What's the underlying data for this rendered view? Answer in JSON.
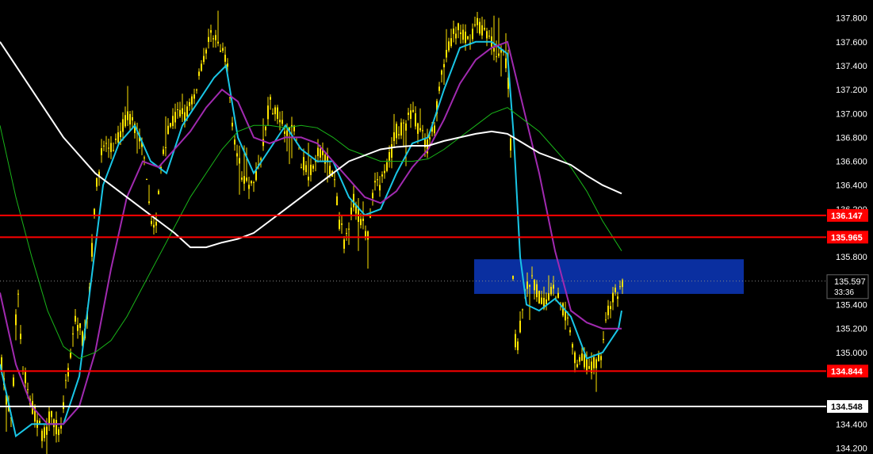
{
  "chart_data": {
    "type": "candlestick",
    "y_axis": {
      "ticks": [
        "137.800",
        "137.600",
        "137.400",
        "137.200",
        "137.000",
        "136.800",
        "136.600",
        "136.400",
        "136.200",
        "135.800",
        "135.400",
        "135.200",
        "135.000",
        "134.400",
        "134.200"
      ],
      "range": [
        134.15,
        137.95
      ],
      "position": "right"
    },
    "grid": false,
    "current_price": {
      "value": "135.597",
      "timer": "33:36"
    },
    "horizontal_levels": [
      {
        "value": "136.147",
        "color": "#ff0000"
      },
      {
        "value": "135.965",
        "color": "#ff0000"
      },
      {
        "value": "134.844",
        "color": "#ff0000"
      },
      {
        "value": "134.548",
        "color": "#ffffff"
      }
    ],
    "zone": {
      "from": 135.49,
      "to": 135.78,
      "color": "#0a2fa0"
    },
    "candle_color": "#ffe400",
    "moving_averages": [
      {
        "color": "#19c6e6"
      },
      {
        "color": "#a12ab0"
      },
      {
        "color": "#19b519"
      },
      {
        "color": "#ffffff"
      }
    ],
    "price_path": [
      [
        0,
        135.0
      ],
      [
        8,
        134.6
      ],
      [
        15,
        134.4
      ],
      [
        22,
        135.6
      ],
      [
        28,
        134.9
      ],
      [
        38,
        134.6
      ],
      [
        48,
        134.4
      ],
      [
        55,
        134.3
      ],
      [
        65,
        134.5
      ],
      [
        75,
        134.3
      ],
      [
        85,
        134.8
      ],
      [
        95,
        135.3
      ],
      [
        105,
        135.1
      ],
      [
        112,
        135.4
      ],
      [
        120,
        136.3
      ],
      [
        130,
        136.75
      ],
      [
        140,
        136.7
      ],
      [
        150,
        136.8
      ],
      [
        160,
        137.0
      ],
      [
        170,
        136.9
      ],
      [
        180,
        136.7
      ],
      [
        188,
        136.2
      ],
      [
        196,
        136.0
      ],
      [
        205,
        136.7
      ],
      [
        215,
        136.9
      ],
      [
        225,
        137.0
      ],
      [
        235,
        137.0
      ],
      [
        245,
        137.15
      ],
      [
        255,
        137.45
      ],
      [
        263,
        137.6
      ],
      [
        270,
        137.7
      ],
      [
        278,
        137.5
      ],
      [
        285,
        137.5
      ],
      [
        292,
        137.0
      ],
      [
        300,
        136.6
      ],
      [
        310,
        136.4
      ],
      [
        320,
        136.4
      ],
      [
        330,
        136.7
      ],
      [
        340,
        137.1
      ],
      [
        350,
        137.0
      ],
      [
        360,
        136.8
      ],
      [
        370,
        136.9
      ],
      [
        380,
        136.6
      ],
      [
        390,
        136.5
      ],
      [
        400,
        136.7
      ],
      [
        410,
        136.65
      ],
      [
        420,
        136.5
      ],
      [
        428,
        136.1
      ],
      [
        435,
        135.9
      ],
      [
        445,
        136.3
      ],
      [
        455,
        136.1
      ],
      [
        465,
        135.95
      ],
      [
        472,
        136.5
      ],
      [
        480,
        136.4
      ],
      [
        490,
        136.6
      ],
      [
        500,
        136.85
      ],
      [
        510,
        136.9
      ],
      [
        520,
        137.0
      ],
      [
        530,
        136.85
      ],
      [
        540,
        136.7
      ],
      [
        548,
        136.9
      ],
      [
        556,
        137.3
      ],
      [
        564,
        137.5
      ],
      [
        572,
        137.65
      ],
      [
        580,
        137.7
      ],
      [
        590,
        137.6
      ],
      [
        600,
        137.75
      ],
      [
        610,
        137.7
      ],
      [
        620,
        137.6
      ],
      [
        630,
        137.5
      ],
      [
        640,
        137.4
      ],
      [
        645,
        136.6
      ],
      [
        648,
        135.2
      ],
      [
        652,
        135.0
      ],
      [
        658,
        135.3
      ],
      [
        664,
        135.55
      ],
      [
        672,
        135.6
      ],
      [
        680,
        135.45
      ],
      [
        688,
        135.4
      ],
      [
        696,
        135.55
      ],
      [
        706,
        135.45
      ],
      [
        714,
        135.3
      ],
      [
        720,
        135.2
      ],
      [
        726,
        134.9
      ],
      [
        734,
        135.0
      ],
      [
        742,
        134.85
      ],
      [
        750,
        134.9
      ],
      [
        758,
        135.0
      ],
      [
        765,
        135.3
      ],
      [
        772,
        135.45
      ],
      [
        780,
        135.5
      ],
      [
        786,
        135.6
      ]
    ],
    "ma_fast_path": [
      [
        0,
        134.9
      ],
      [
        20,
        134.3
      ],
      [
        40,
        134.4
      ],
      [
        60,
        134.4
      ],
      [
        80,
        134.4
      ],
      [
        100,
        134.8
      ],
      [
        115,
        135.6
      ],
      [
        130,
        136.4
      ],
      [
        150,
        136.75
      ],
      [
        170,
        136.9
      ],
      [
        190,
        136.6
      ],
      [
        210,
        136.5
      ],
      [
        230,
        136.9
      ],
      [
        250,
        137.1
      ],
      [
        270,
        137.3
      ],
      [
        285,
        137.4
      ],
      [
        300,
        136.8
      ],
      [
        320,
        136.5
      ],
      [
        340,
        136.7
      ],
      [
        360,
        136.9
      ],
      [
        380,
        136.7
      ],
      [
        400,
        136.6
      ],
      [
        420,
        136.6
      ],
      [
        440,
        136.3
      ],
      [
        460,
        136.15
      ],
      [
        480,
        136.2
      ],
      [
        500,
        136.5
      ],
      [
        520,
        136.75
      ],
      [
        540,
        136.8
      ],
      [
        560,
        137.2
      ],
      [
        580,
        137.55
      ],
      [
        600,
        137.6
      ],
      [
        620,
        137.6
      ],
      [
        640,
        137.5
      ],
      [
        648,
        136.8
      ],
      [
        656,
        135.8
      ],
      [
        664,
        135.4
      ],
      [
        680,
        135.35
      ],
      [
        700,
        135.45
      ],
      [
        720,
        135.3
      ],
      [
        740,
        134.95
      ],
      [
        760,
        135.0
      ],
      [
        780,
        135.2
      ],
      [
        784,
        135.35
      ]
    ],
    "ma_mid_path": [
      [
        0,
        135.5
      ],
      [
        20,
        134.9
      ],
      [
        40,
        134.55
      ],
      [
        60,
        134.4
      ],
      [
        80,
        134.4
      ],
      [
        100,
        134.55
      ],
      [
        120,
        135.0
      ],
      [
        140,
        135.7
      ],
      [
        160,
        136.3
      ],
      [
        180,
        136.6
      ],
      [
        200,
        136.55
      ],
      [
        220,
        136.7
      ],
      [
        240,
        136.85
      ],
      [
        260,
        137.05
      ],
      [
        280,
        137.2
      ],
      [
        300,
        137.1
      ],
      [
        320,
        136.8
      ],
      [
        340,
        136.75
      ],
      [
        360,
        136.8
      ],
      [
        380,
        136.8
      ],
      [
        400,
        136.75
      ],
      [
        420,
        136.6
      ],
      [
        440,
        136.45
      ],
      [
        460,
        136.3
      ],
      [
        480,
        136.25
      ],
      [
        500,
        136.35
      ],
      [
        520,
        136.55
      ],
      [
        540,
        136.7
      ],
      [
        560,
        136.95
      ],
      [
        580,
        137.25
      ],
      [
        600,
        137.45
      ],
      [
        620,
        137.55
      ],
      [
        640,
        137.6
      ],
      [
        660,
        137.05
      ],
      [
        680,
        136.5
      ],
      [
        700,
        135.85
      ],
      [
        720,
        135.35
      ],
      [
        740,
        135.25
      ],
      [
        760,
        135.2
      ],
      [
        784,
        135.2
      ]
    ],
    "ma_slow_path": [
      [
        0,
        136.9
      ],
      [
        20,
        136.3
      ],
      [
        40,
        135.8
      ],
      [
        60,
        135.35
      ],
      [
        80,
        135.05
      ],
      [
        100,
        134.95
      ],
      [
        120,
        135.0
      ],
      [
        140,
        135.1
      ],
      [
        160,
        135.3
      ],
      [
        180,
        135.55
      ],
      [
        200,
        135.8
      ],
      [
        220,
        136.05
      ],
      [
        240,
        136.3
      ],
      [
        260,
        136.5
      ],
      [
        280,
        136.7
      ],
      [
        300,
        136.85
      ],
      [
        320,
        136.9
      ],
      [
        340,
        136.9
      ],
      [
        360,
        136.88
      ],
      [
        380,
        136.9
      ],
      [
        400,
        136.88
      ],
      [
        420,
        136.8
      ],
      [
        440,
        136.7
      ],
      [
        460,
        136.65
      ],
      [
        480,
        136.6
      ],
      [
        500,
        136.6
      ],
      [
        520,
        136.6
      ],
      [
        540,
        136.62
      ],
      [
        560,
        136.7
      ],
      [
        580,
        136.8
      ],
      [
        600,
        136.9
      ],
      [
        620,
        137.0
      ],
      [
        640,
        137.05
      ],
      [
        660,
        136.95
      ],
      [
        680,
        136.85
      ],
      [
        700,
        136.7
      ],
      [
        720,
        136.55
      ],
      [
        740,
        136.35
      ],
      [
        760,
        136.1
      ],
      [
        784,
        135.85
      ]
    ],
    "ma_long_path": [
      [
        0,
        137.6
      ],
      [
        20,
        137.4
      ],
      [
        40,
        137.2
      ],
      [
        60,
        137.0
      ],
      [
        80,
        136.8
      ],
      [
        100,
        136.65
      ],
      [
        120,
        136.5
      ],
      [
        140,
        136.4
      ],
      [
        160,
        136.3
      ],
      [
        180,
        136.2
      ],
      [
        200,
        136.1
      ],
      [
        220,
        136.0
      ],
      [
        240,
        135.88
      ],
      [
        260,
        135.88
      ],
      [
        280,
        135.92
      ],
      [
        300,
        135.95
      ],
      [
        320,
        136.0
      ],
      [
        340,
        136.1
      ],
      [
        360,
        136.2
      ],
      [
        380,
        136.3
      ],
      [
        400,
        136.4
      ],
      [
        420,
        136.5
      ],
      [
        440,
        136.6
      ],
      [
        460,
        136.65
      ],
      [
        480,
        136.7
      ],
      [
        500,
        136.72
      ],
      [
        520,
        136.73
      ],
      [
        540,
        136.73
      ],
      [
        560,
        136.77
      ],
      [
        580,
        136.8
      ],
      [
        600,
        136.83
      ],
      [
        620,
        136.85
      ],
      [
        640,
        136.83
      ],
      [
        660,
        136.75
      ],
      [
        680,
        136.67
      ],
      [
        700,
        136.62
      ],
      [
        720,
        136.57
      ],
      [
        740,
        136.48
      ],
      [
        760,
        136.4
      ],
      [
        784,
        136.33
      ]
    ]
  }
}
